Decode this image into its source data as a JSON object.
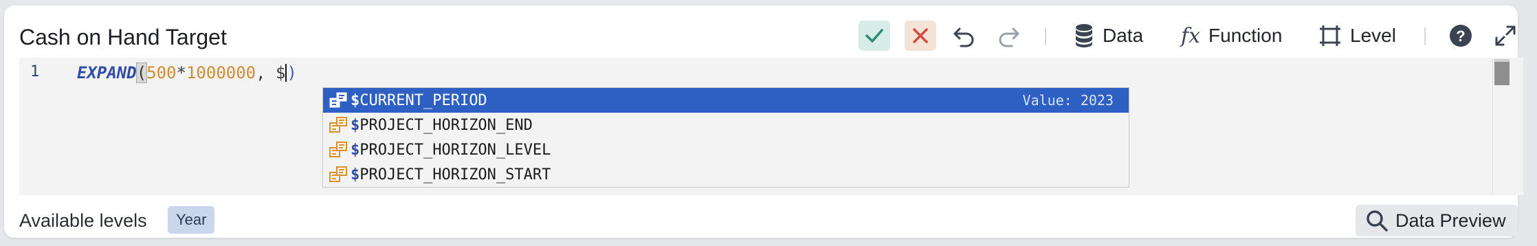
{
  "dialog": {
    "title": "Cash on Hand Target"
  },
  "toolbar": {
    "confirm_icon": "check-icon",
    "cancel_icon": "close-icon",
    "undo_icon": "undo-icon",
    "redo_icon": "redo-icon",
    "data_label": "Data",
    "function_label": "Function",
    "level_label": "Level",
    "help_icon": "question-circle-icon",
    "expand_icon": "expand-icon"
  },
  "editor": {
    "line_number": "1",
    "tokens": {
      "fn": "EXPAND",
      "open": "(",
      "num1": "500",
      "op": "*",
      "num2": "1000000",
      "comma": ", ",
      "dollar": "$",
      "close": ")"
    }
  },
  "suggestions": {
    "items": [
      {
        "prefix": "$",
        "name": "CURRENT_PERIOD",
        "meta": "Value: 2023",
        "selected": true
      },
      {
        "prefix": "$",
        "name": "PROJECT_HORIZON_END",
        "meta": "",
        "selected": false
      },
      {
        "prefix": "$",
        "name": "PROJECT_HORIZON_LEVEL",
        "meta": "",
        "selected": false
      },
      {
        "prefix": "$",
        "name": "PROJECT_HORIZON_START",
        "meta": "",
        "selected": false
      }
    ]
  },
  "footer": {
    "levels_label": "Available levels",
    "level_badge": "Year",
    "preview_label": "Data Preview"
  },
  "colors": {
    "selection": "#2e5fc2",
    "function_token": "#2f4ea8",
    "number_token": "#d08c32",
    "confirm_bg": "#d7ebe7",
    "cancel_bg": "#f6e3d8",
    "badge_bg": "#c9d6ec"
  }
}
